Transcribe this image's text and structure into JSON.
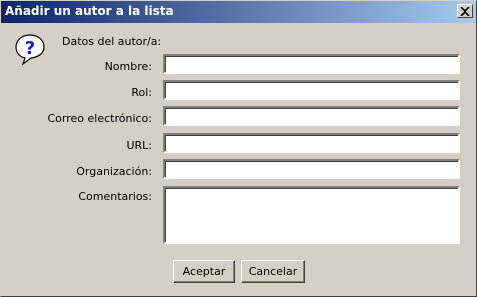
{
  "window": {
    "title": "Añadir un autor a la lista",
    "close_symbol": "×"
  },
  "header": {
    "icon": "question-help-icon",
    "text": "Datos del autor/a:"
  },
  "form": {
    "fields": [
      {
        "label": "Nombre:",
        "value": ""
      },
      {
        "label": "Rol:",
        "value": ""
      },
      {
        "label": "Correo electrónico:",
        "value": ""
      },
      {
        "label": "URL:",
        "value": ""
      },
      {
        "label": "Organización:",
        "value": ""
      },
      {
        "label": "Comentarios:",
        "value": ""
      }
    ]
  },
  "buttons": {
    "accept": "Aceptar",
    "cancel": "Cancelar"
  }
}
